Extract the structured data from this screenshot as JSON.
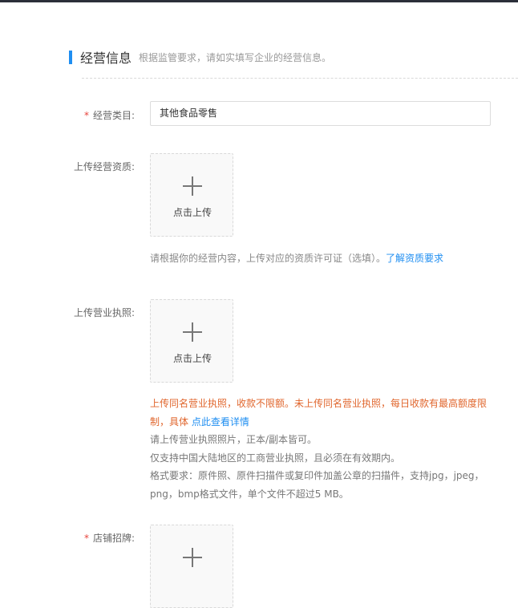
{
  "section": {
    "title": "经营信息",
    "subtitle": "根据监管要求，请如实填写企业的经营信息。"
  },
  "business_category": {
    "required_mark": "*",
    "label": "经营类目:",
    "value": "其他食品零售"
  },
  "qualification": {
    "label": "上传经营资质:",
    "upload_text": "点击上传",
    "help_text": "请根据你的经营内容，上传对应的资质许可证（选填）。",
    "help_link": "了解资质要求"
  },
  "license": {
    "label": "上传营业执照:",
    "upload_text": "点击上传",
    "warning_line1": "上传同名营业执照，收款不限额。未上传同名营业执照，每日收款有最高额度限",
    "warning_line2": "制，具体",
    "warning_link": "点此查看详情",
    "note1": "请上传营业执照照片，正本/副本皆可。",
    "note2": "仅支持中国大陆地区的工商营业执照，且必须在有效期内。",
    "note3": "格式要求：原件照、原件扫描件或复印件加盖公章的扫描件，支持jpg，jpeg，",
    "note4": "png，bmp格式文件，单个文件不超过5 MB。"
  },
  "shop_sign": {
    "required_mark": "*",
    "label": "店铺招牌:"
  }
}
